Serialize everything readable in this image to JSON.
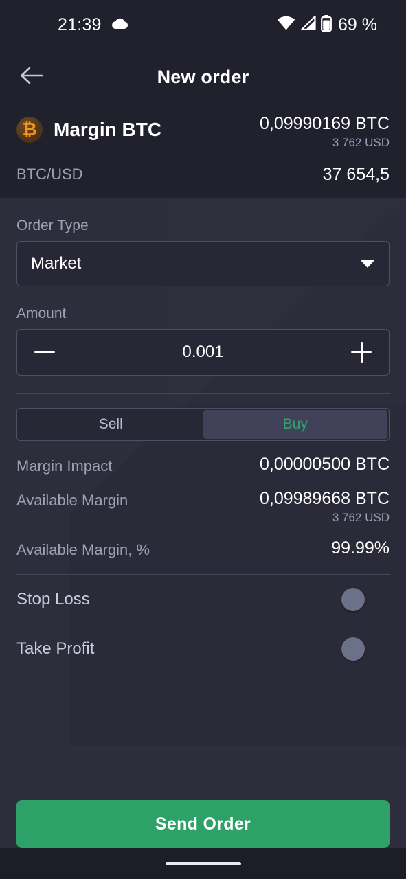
{
  "status_bar": {
    "time": "21:39",
    "cloud_icon": "cloud-icon",
    "wifi_icon": "wifi-icon",
    "signal_icon": "signal-triangle-icon",
    "battery_icon": "battery-icon",
    "battery_text": "69 %"
  },
  "app_bar": {
    "back_icon": "arrow-left-icon",
    "title": "New order"
  },
  "instrument": {
    "logo_icon": "bitcoin-icon",
    "logo_glyph": "₿",
    "name": "Margin BTC",
    "balance": "0,09990169 BTC",
    "balance_fiat": "3 762 USD",
    "pair_label": "BTC/USD",
    "pair_price": "37 654,5"
  },
  "form": {
    "order_type_label": "Order Type",
    "order_type_value": "Market",
    "order_type_caret": "chevron-down-icon",
    "amount_label": "Amount",
    "amount_value": "0.001",
    "decrement_icon": "minus-icon",
    "increment_icon": "plus-icon",
    "side_sell": "Sell",
    "side_buy": "Buy",
    "side_selected": "Buy"
  },
  "summary": [
    {
      "key": "Margin Impact",
      "value": "0,00000500 BTC",
      "sub": ""
    },
    {
      "key": "Available Margin",
      "value": "0,09989668 BTC",
      "sub": "3 762 USD"
    },
    {
      "key": "Available Margin, %",
      "value": "99.99%",
      "sub": ""
    }
  ],
  "toggles": [
    {
      "label": "Stop Loss",
      "state": "off"
    },
    {
      "label": "Take Profit",
      "state": "off"
    }
  ],
  "footer": {
    "send_label": "Send Order"
  },
  "nav": {
    "home_indicator": "home-indicator"
  },
  "colors": {
    "header_bg": "#21212e",
    "body_bg": "#2d2d3c",
    "accent_green": "#2ea168",
    "buy_green_text": "#2fa46c",
    "muted_text": "#9ca0b5",
    "bitcoin_orange": "#f7931a",
    "nav_bg": "#1d1d28"
  }
}
